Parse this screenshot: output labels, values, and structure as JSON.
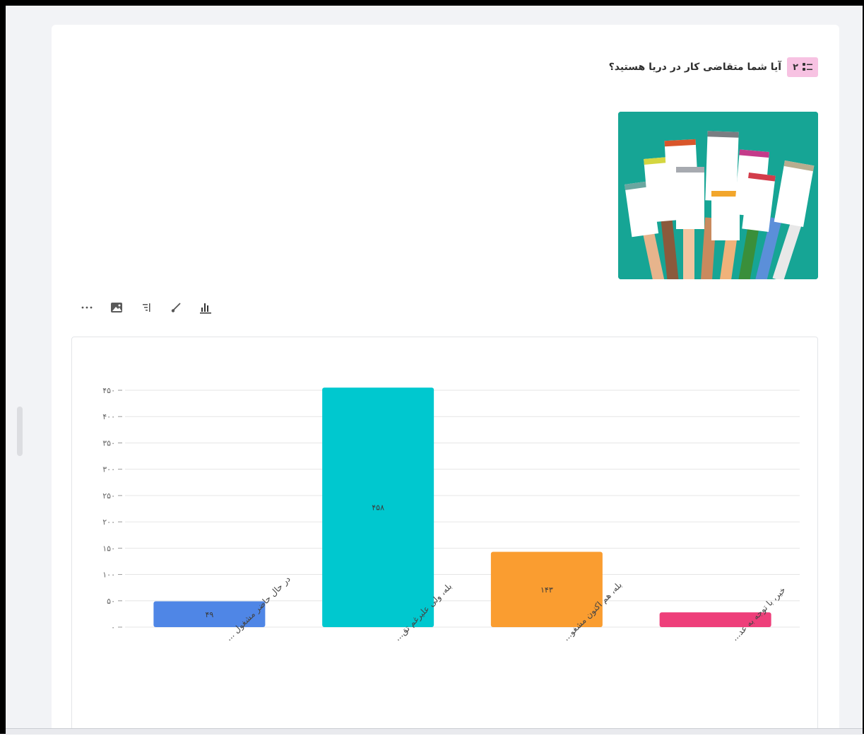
{
  "question": {
    "number": "۲",
    "text": "آیا شما متقاضی کار در دریا هستید؟"
  },
  "colors": {
    "badge": "#f7c2e2",
    "bar1": "#4f86e6",
    "bar2": "#00c8cf",
    "bar3": "#fa9d30",
    "bar4": "#ee3f7a"
  },
  "toolbar": {
    "icons": [
      "bar-chart-icon",
      "brush-icon",
      "sort-icon",
      "image-icon",
      "more-icon"
    ]
  },
  "chart_data": {
    "type": "bar",
    "categories": [
      "در حال حاضر مشغول ...",
      "بله، ولی علیرغم تق...",
      "بله، هم اکنون مشغو...",
      "خیر، با توجه به عد..."
    ],
    "values": [
      49,
      458,
      143,
      28
    ],
    "value_labels": [
      "۴۹",
      "۴۵۸",
      "۱۴۳",
      ""
    ],
    "ylim": [
      0,
      450
    ],
    "yticks": [
      0,
      50,
      100,
      150,
      200,
      250,
      300,
      350,
      400,
      450
    ],
    "ytick_labels": [
      "۰",
      "۵۰",
      "۱۰۰",
      "۱۵۰",
      "۲۰۰",
      "۲۵۰",
      "۳۰۰",
      "۳۵۰",
      "۴۰۰",
      "۴۵۰"
    ],
    "grid": true,
    "title": "",
    "xlabel": "",
    "ylabel": ""
  }
}
